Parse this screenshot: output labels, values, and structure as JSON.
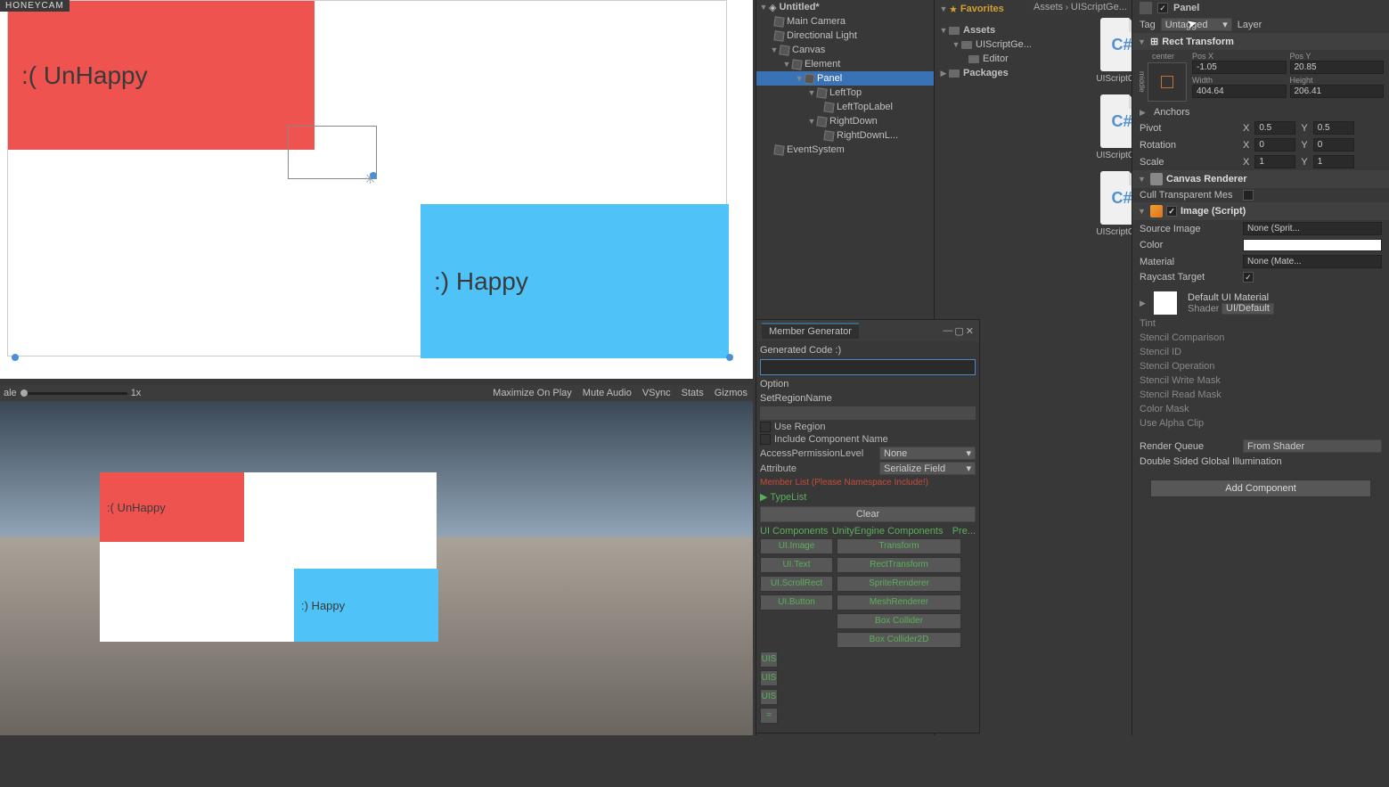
{
  "honeycam": "HONEYCAM",
  "scene": {
    "unhappy_text": ":( UnHappy",
    "happy_text": ":) Happy"
  },
  "game_toolbar": {
    "scale_label": "ale",
    "scale_value": "1x",
    "maximize": "Maximize On Play",
    "mute": "Mute Audio",
    "vsync": "VSync",
    "stats": "Stats",
    "gizmos": "Gizmos"
  },
  "hierarchy": {
    "scene_name": "Untitled*",
    "items": [
      "Main Camera",
      "Directional Light",
      "Canvas",
      "Element",
      "Panel",
      "LeftTop",
      "LeftTopLabel",
      "RightDown",
      "RightDownL...",
      "EventSystem"
    ]
  },
  "project": {
    "favorites": "Favorites",
    "breadcrumb_assets": "Assets",
    "breadcrumb_folder": "UIScriptGe...",
    "assets": "Assets",
    "uiscriptge": "UIScriptGe...",
    "editor": "Editor",
    "packages": "Packages",
    "item_name": "UIScriptGe...",
    "cs_label": "C#"
  },
  "membergen": {
    "title": "Member Generator",
    "generated": "Generated Code :)",
    "option": "Option",
    "set_region": "SetRegionName",
    "use_region": "Use Region",
    "include_comp": "Include Component Name",
    "access_perm": "AccessPermissionLevel",
    "access_val": "None",
    "attribute": "Attribute",
    "attribute_val": "Serialize Field",
    "warn": "Member List (Please Namespace Include!)",
    "typelist": "TypeList",
    "clear": "Clear",
    "cat_ui": "UI Components",
    "cat_engine": "UnityEngine Components",
    "cat_pre": "Pre...",
    "btns_col1": [
      "UI.Image",
      "UI.Text",
      "UI.ScrollRect",
      "UI.Button"
    ],
    "btns_col2": [
      "Transform",
      "RectTransform",
      "SpriteRenderer",
      "MeshRenderer",
      "Box Collider",
      "Box Collider2D"
    ],
    "btns_col3": [
      "UIS",
      "UIS",
      "UIS",
      "="
    ]
  },
  "inspector": {
    "obj_name": "Panel",
    "tag_label": "Tag",
    "tag_value": "Untagged",
    "layer_label": "Layer",
    "rect_transform": "Rect Transform",
    "center": "center",
    "middle": "middle",
    "posx": "Pos X",
    "posx_v": "-1.05",
    "posy": "Pos Y",
    "posy_v": "20.85",
    "width": "Width",
    "width_v": "404.64",
    "height": "Height",
    "height_v": "206.41",
    "anchors": "Anchors",
    "pivot": "Pivot",
    "pivot_x": "0.5",
    "pivot_y": "0.5",
    "rotation": "Rotation",
    "rot_x": "0",
    "rot_y": "0",
    "scale": "Scale",
    "scale_x": "1",
    "scale_y": "1",
    "X": "X",
    "Y": "Y",
    "canvas_renderer": "Canvas Renderer",
    "cull_transparent": "Cull Transparent Mes",
    "image_script": "Image (Script)",
    "source_image": "Source Image",
    "source_image_v": "None (Sprit...",
    "color": "Color",
    "material": "Material",
    "material_v": "None (Mate...",
    "raycast": "Raycast Target",
    "default_mat": "Default UI Material",
    "shader": "Shader",
    "shader_v": "UI/Default",
    "tint": "Tint",
    "stencil_comp": "Stencil Comparison",
    "stencil_id": "Stencil ID",
    "stencil_op": "Stencil Operation",
    "stencil_write": "Stencil Write Mask",
    "stencil_read": "Stencil Read Mask",
    "color_mask": "Color Mask",
    "use_alpha": "Use Alpha Clip",
    "render_queue": "Render Queue",
    "render_queue_v": "From Shader",
    "double_sided": "Double Sided Global Illumination",
    "add_component": "Add Component"
  }
}
